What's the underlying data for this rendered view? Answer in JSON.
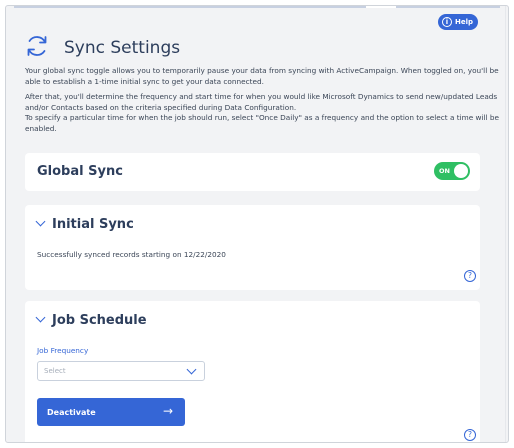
{
  "help": {
    "label": "Help",
    "icon": "info-icon"
  },
  "header": {
    "title": "Sync Settings",
    "icon": "sync-icon"
  },
  "description": {
    "p1": "Your global sync toggle allows you to temporarily pause your data from syncing with ActiveCampaign. When toggled on, you'll be able to establish a 1-time initial sync to get your data connected.",
    "p2": "After that, you'll determine the frequency and start time for when you would like Microsoft Dynamics to send new/updated Leads and/or Contacts based on the criteria specified during Data Configuration.",
    "p3": "To specify a particular time for when the job should run, select \"Once Daily\" as a frequency and the option to select a time will be enabled."
  },
  "global_sync": {
    "title": "Global Sync",
    "toggle_label": "ON",
    "toggle_state": "on",
    "toggle_color": "#2fbf63"
  },
  "initial_sync": {
    "title": "Initial Sync",
    "status": "Successfully synced records starting on 12/22/2020",
    "help_glyph": "?"
  },
  "job_schedule": {
    "title": "Job Schedule",
    "frequency_label": "Job Frequency",
    "frequency_placeholder": "Select",
    "button_label": "Deactivate",
    "button_arrow": "→",
    "help_glyph": "?"
  },
  "colors": {
    "accent": "#3566d6",
    "background": "#f2f3f5",
    "card": "#ffffff"
  }
}
